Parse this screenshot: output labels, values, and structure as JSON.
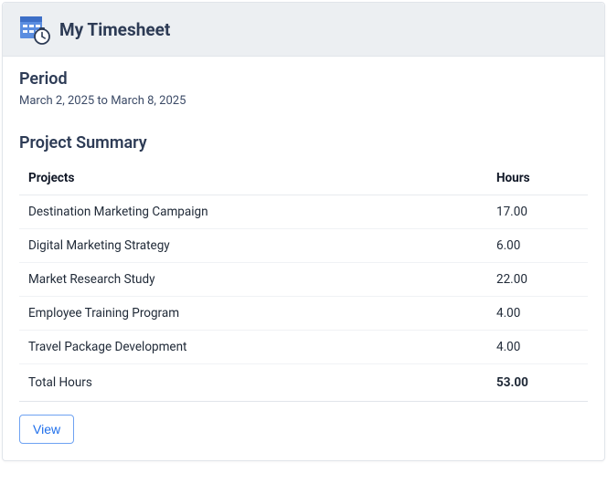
{
  "header": {
    "title": "My Timesheet"
  },
  "period": {
    "label": "Period",
    "range": "March 2, 2025 to March 8, 2025"
  },
  "summary": {
    "title": "Project Summary",
    "col_projects": "Projects",
    "col_hours": "Hours",
    "rows": [
      {
        "project": "Destination Marketing Campaign",
        "hours": "17.00"
      },
      {
        "project": "Digital Marketing Strategy",
        "hours": "6.00"
      },
      {
        "project": "Market Research Study",
        "hours": "22.00"
      },
      {
        "project": "Employee Training Program",
        "hours": "4.00"
      },
      {
        "project": "Travel Package Development",
        "hours": "4.00"
      }
    ],
    "total_label": "Total Hours",
    "total_hours": "53.00"
  },
  "actions": {
    "view_label": "View"
  }
}
